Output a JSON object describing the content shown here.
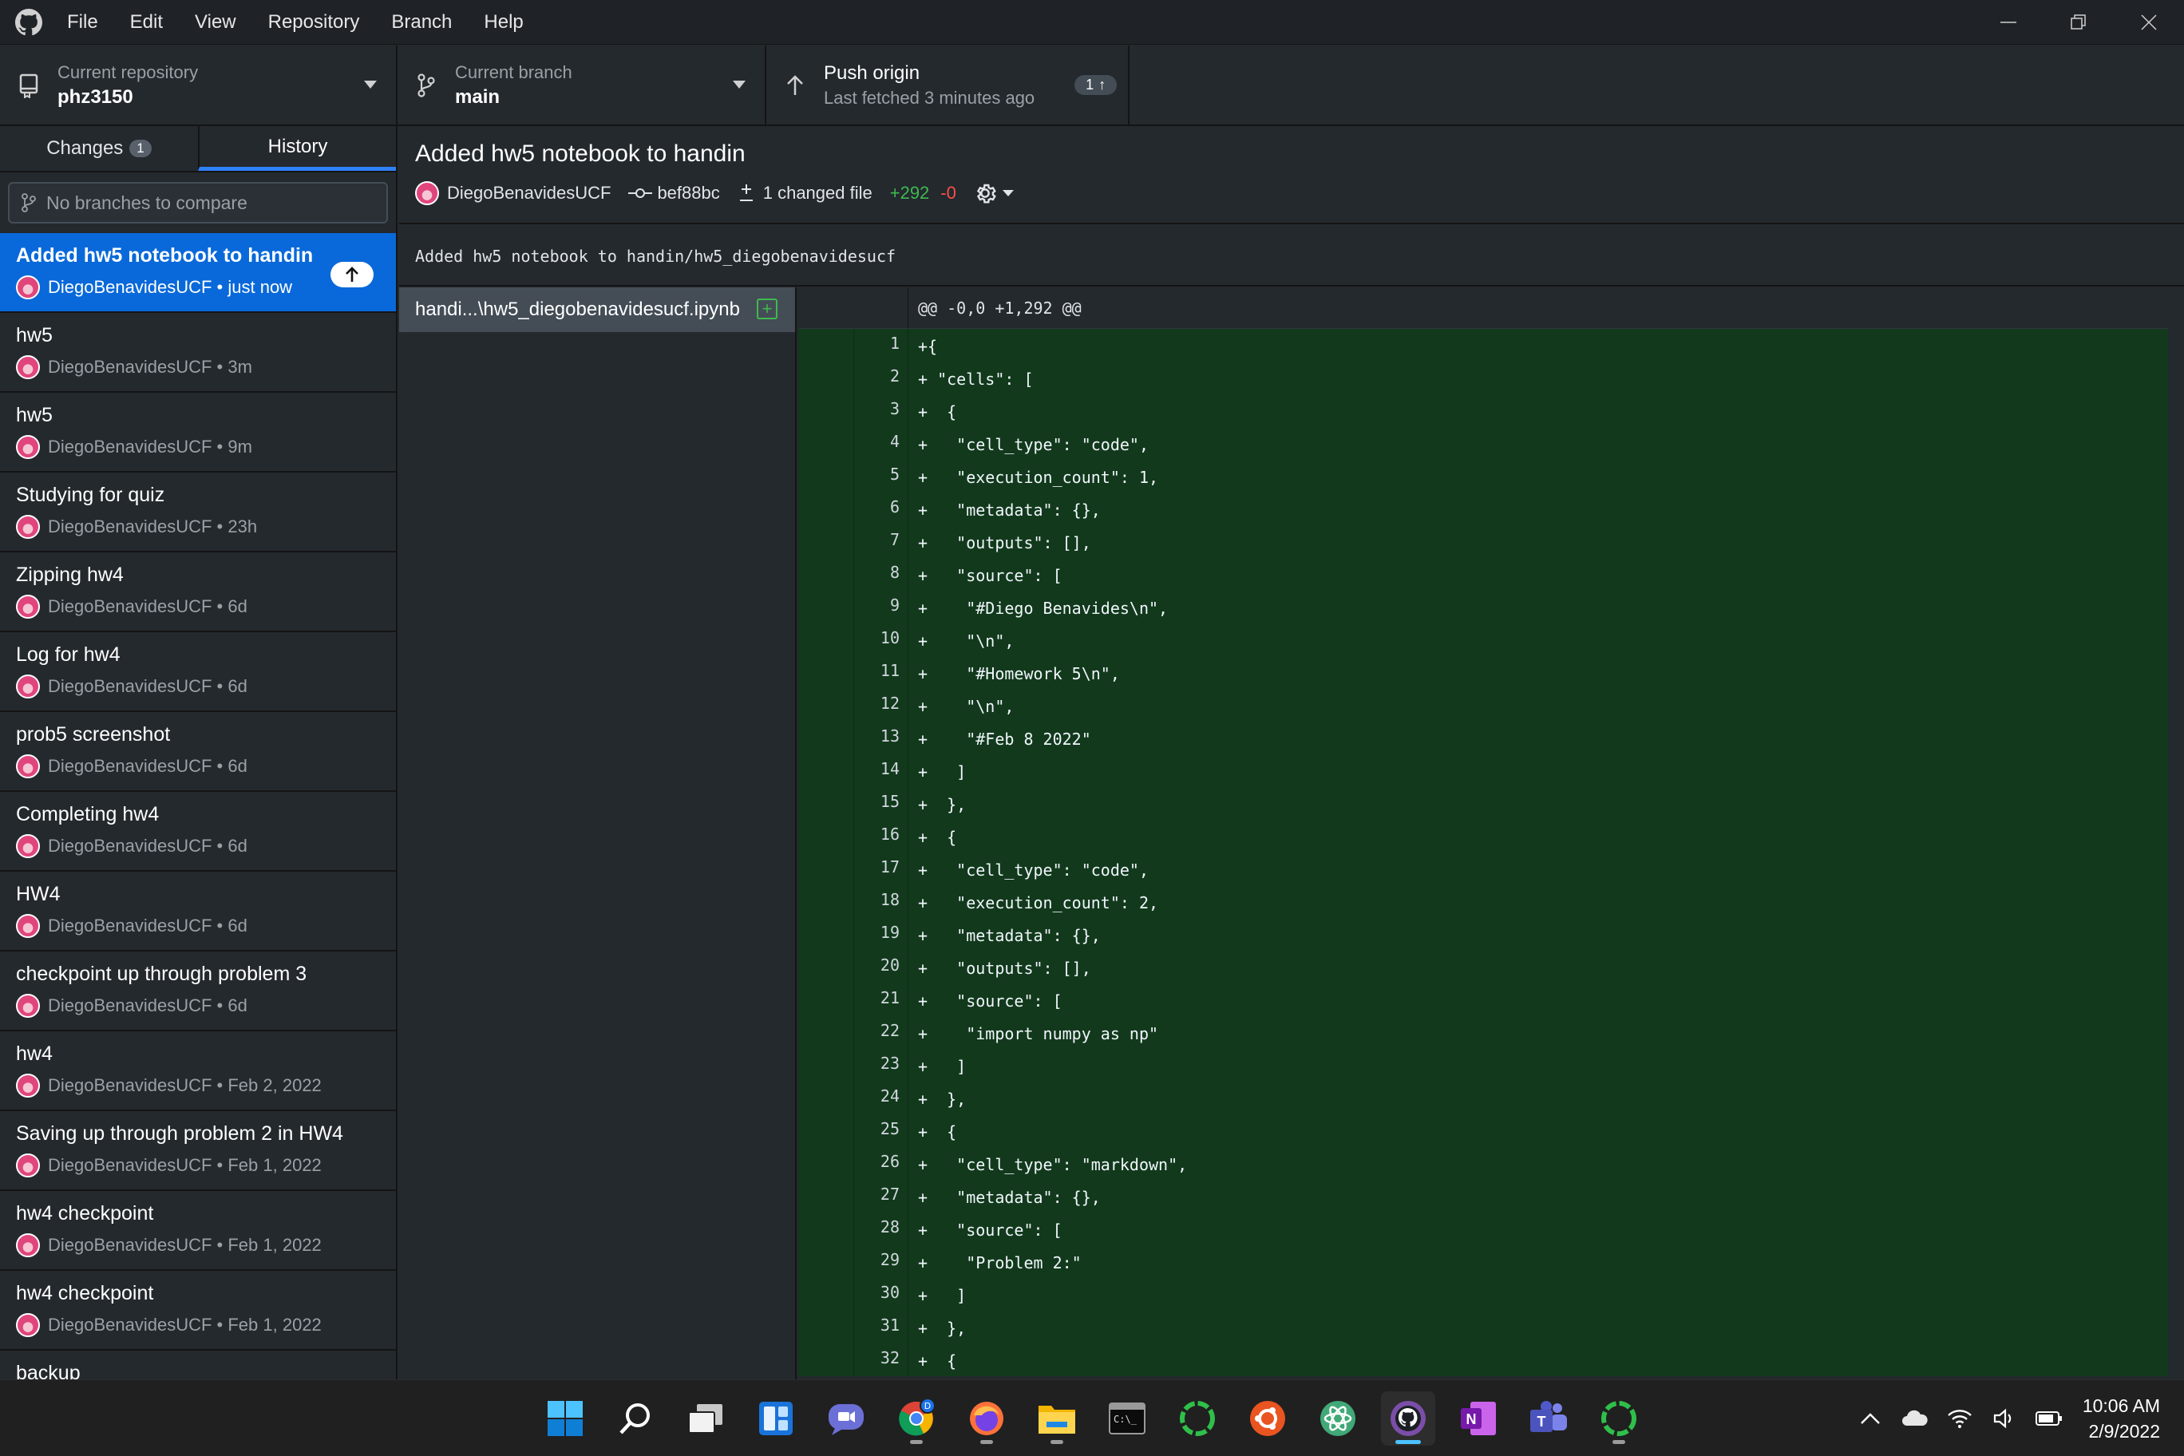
{
  "menu": [
    "File",
    "Edit",
    "View",
    "Repository",
    "Branch",
    "Help"
  ],
  "toolbar": {
    "repo_label": "Current repository",
    "repo_name": "phz3150",
    "branch_label": "Current branch",
    "branch_name": "main",
    "push_title": "Push origin",
    "push_subtitle": "Last fetched 3 minutes ago",
    "push_count": "1"
  },
  "sidebar": {
    "tab_changes": "Changes",
    "changes_count": "1",
    "tab_history": "History",
    "compare_placeholder": "No branches to compare",
    "commits": [
      {
        "title": "Added hw5 notebook to handin",
        "meta": "DiegoBenavidesUCF • just now"
      },
      {
        "title": "hw5",
        "meta": "DiegoBenavidesUCF • 3m"
      },
      {
        "title": "hw5",
        "meta": "DiegoBenavidesUCF • 9m"
      },
      {
        "title": "Studying for quiz",
        "meta": "DiegoBenavidesUCF • 23h"
      },
      {
        "title": "Zipping hw4",
        "meta": "DiegoBenavidesUCF • 6d"
      },
      {
        "title": "Log for hw4",
        "meta": "DiegoBenavidesUCF • 6d"
      },
      {
        "title": "prob5 screenshot",
        "meta": "DiegoBenavidesUCF • 6d"
      },
      {
        "title": "Completing hw4",
        "meta": "DiegoBenavidesUCF • 6d"
      },
      {
        "title": "HW4",
        "meta": "DiegoBenavidesUCF • 6d"
      },
      {
        "title": "checkpoint up through problem 3",
        "meta": "DiegoBenavidesUCF • 6d"
      },
      {
        "title": "hw4",
        "meta": "DiegoBenavidesUCF • Feb 2, 2022"
      },
      {
        "title": "Saving up through problem 2 in HW4",
        "meta": "DiegoBenavidesUCF • Feb 1, 2022"
      },
      {
        "title": "hw4 checkpoint",
        "meta": "DiegoBenavidesUCF • Feb 1, 2022"
      },
      {
        "title": "hw4 checkpoint",
        "meta": "DiegoBenavidesUCF • Feb 1, 2022"
      },
      {
        "title": "backup",
        "meta": ""
      }
    ]
  },
  "detail": {
    "heading": "Added hw5 notebook to handin",
    "author": "DiegoBenavidesUCF",
    "sha": "bef88bc",
    "changed_files": "1 changed file",
    "additions": "+292",
    "deletions": "-0",
    "message": "Added hw5 notebook to handin/hw5_diegobenavidesucf",
    "file_name": "handi...\\hw5_diegobenavidesucf.ipynb"
  },
  "diff": {
    "hunk": "@@ -0,0 +1,292 @@",
    "lines": [
      "+{",
      "+ \"cells\": [",
      "+  {",
      "+   \"cell_type\": \"code\",",
      "+   \"execution_count\": 1,",
      "+   \"metadata\": {},",
      "+   \"outputs\": [],",
      "+   \"source\": [",
      "+    \"#Diego Benavides\\n\",",
      "+    \"\\n\",",
      "+    \"#Homework 5\\n\",",
      "+    \"\\n\",",
      "+    \"#Feb 8 2022\"",
      "+   ]",
      "+  },",
      "+  {",
      "+   \"cell_type\": \"code\",",
      "+   \"execution_count\": 2,",
      "+   \"metadata\": {},",
      "+   \"outputs\": [],",
      "+   \"source\": [",
      "+    \"import numpy as np\"",
      "+   ]",
      "+  },",
      "+  {",
      "+   \"cell_type\": \"markdown\",",
      "+   \"metadata\": {},",
      "+   \"source\": [",
      "+    \"Problem 2:\"",
      "+   ]",
      "+  },",
      "+  {"
    ]
  },
  "taskbar": {
    "apps": [
      "start-icon",
      "search-icon",
      "task-view-icon",
      "widgets-icon",
      "chat-icon",
      "chrome-icon",
      "firefox-icon",
      "file-explorer-icon",
      "terminal-icon",
      "loading-app-icon",
      "ubuntu-icon",
      "atom-icon",
      "github-desktop-icon",
      "onenote-icon",
      "teams-icon",
      "loading-app-icon-2"
    ],
    "time": "10:06 AM",
    "date": "2/9/2022"
  },
  "colors": {
    "accent": "#0969da",
    "diff_added_bg": "#12391c",
    "added_text": "#3fb950",
    "removed_text": "#f85149"
  }
}
